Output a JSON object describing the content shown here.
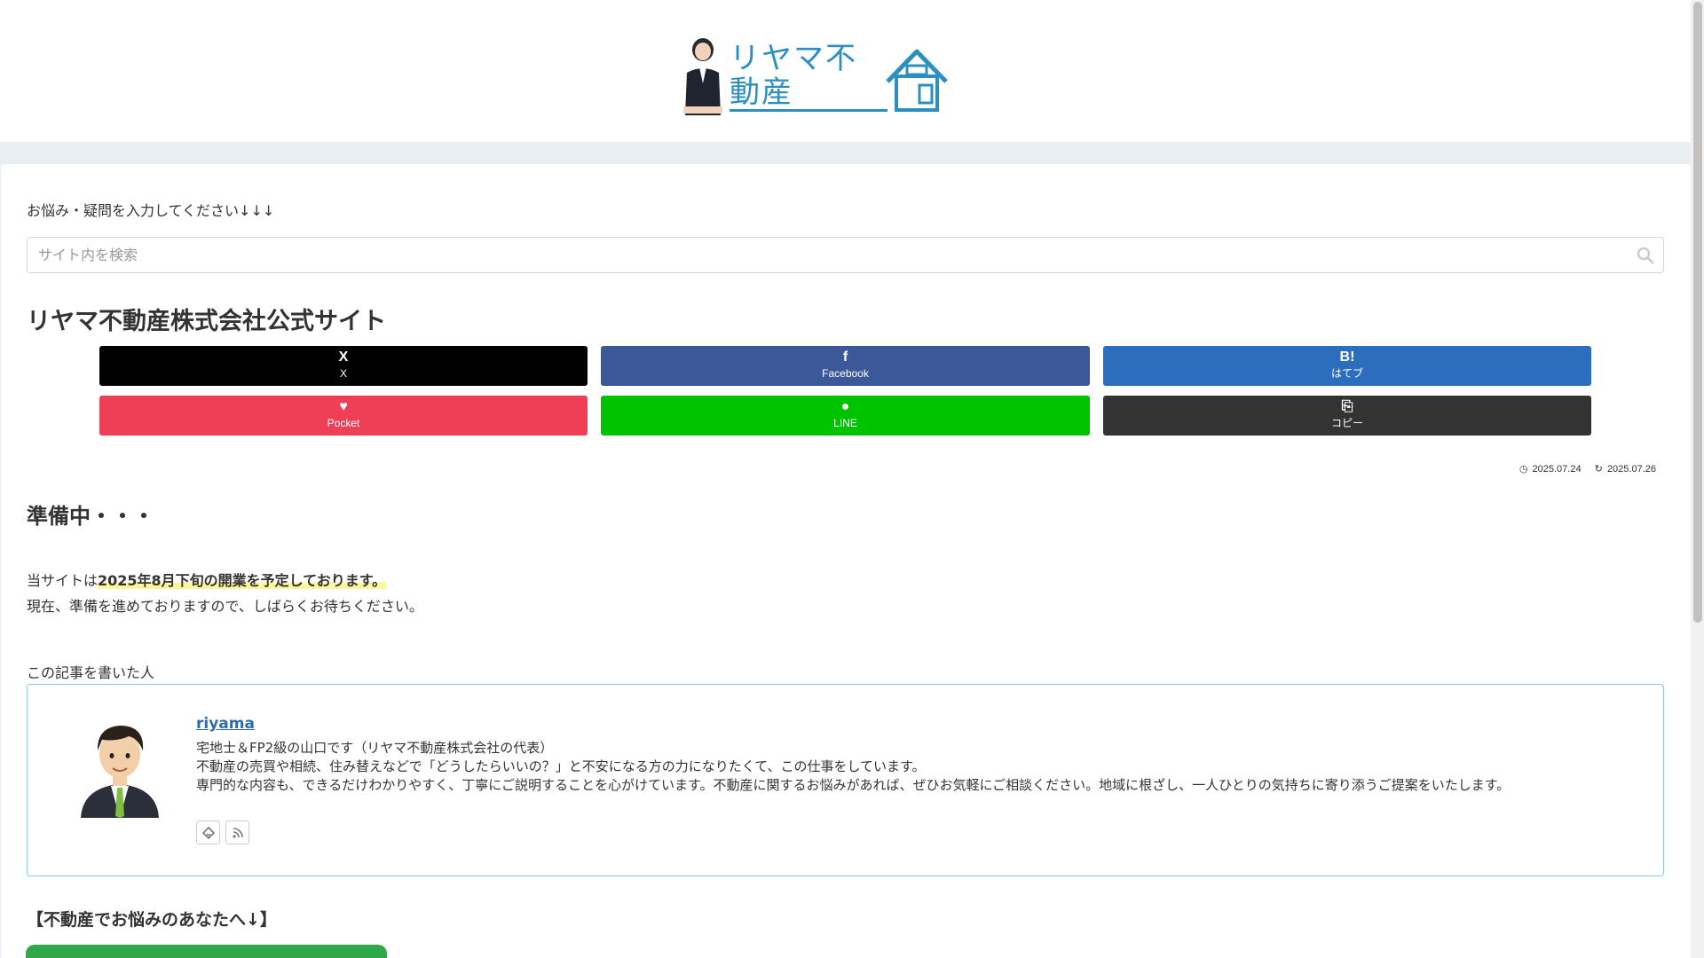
{
  "header": {
    "logo_text": "リヤマ不動産"
  },
  "search": {
    "label": "お悩み・疑問を入力してください↓↓↓",
    "placeholder": "サイト内を検索"
  },
  "page": {
    "title": "リヤマ不動産株式会社公式サイト"
  },
  "share": {
    "buttons": [
      {
        "icon": "X",
        "label": "X",
        "color": "#000000"
      },
      {
        "icon": "f",
        "label": "Facebook",
        "color": "#3b5998"
      },
      {
        "icon": "B!",
        "label": "はてブ",
        "color": "#2c6ebd"
      },
      {
        "icon": "♥",
        "label": "Pocket",
        "color": "#ef3f56"
      },
      {
        "icon": "●",
        "label": "LINE",
        "color": "#00c300"
      },
      {
        "icon": "⎘",
        "label": "コピー",
        "color": "#333333"
      }
    ]
  },
  "post": {
    "published": "2025.07.24",
    "updated": "2025.07.26",
    "heading": "準備中・・・",
    "line1_prefix": "当サイトは",
    "line1_marker": "2025年8月下旬の開業を予定しております。",
    "line2": "現在、準備を進めておりますので、しばらくお待ちください。"
  },
  "author": {
    "section_label": "この記事を書いた人",
    "name": "riyama",
    "desc1": "宅地士＆FP2級の山口です（リヤマ不動産株式会社の代表）",
    "desc2": "不動産の売買や相続、住み替えなどで「どうしたらいいの？」と不安になる方の力になりたくて、この仕事をしています。",
    "desc3": "専門的な内容も、できるだけわかりやすく、丁寧にご説明することを心がけています。不動産に関するお悩みがあれば、ぜひお気軽にご相談ください。地域に根ざし、一人ひとりの気持ちに寄り添うご提案をいたします。"
  },
  "cta": {
    "heading": "【不動産でお悩みのあなたへ↓】"
  },
  "colors": {
    "accent": "#2c8fbf",
    "cta_green": "#2ea84a",
    "author_border": "#8ec5e6"
  }
}
